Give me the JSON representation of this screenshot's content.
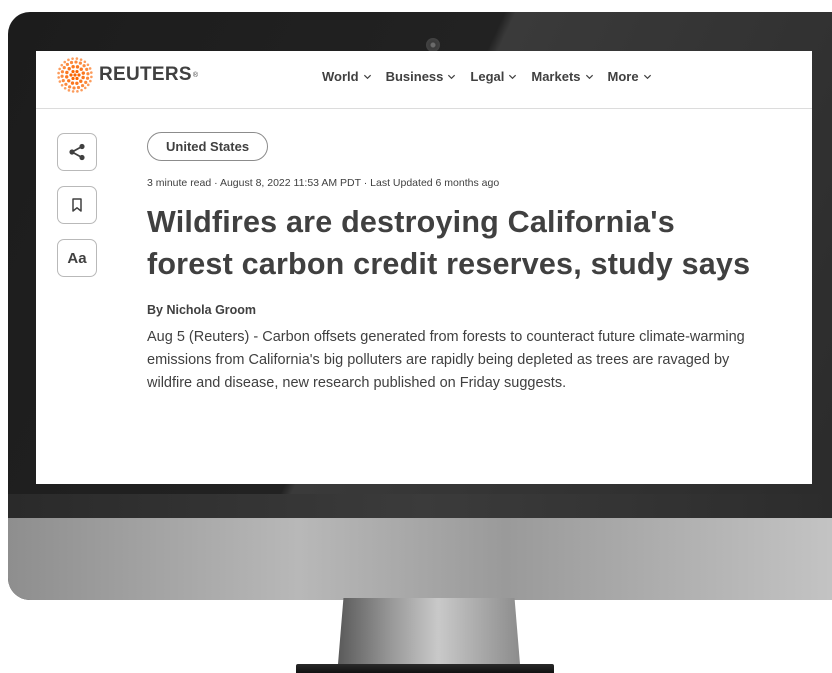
{
  "brand": {
    "name": "REUTERS",
    "registered": "®",
    "accent_color": "#FA6400"
  },
  "nav": {
    "items": [
      {
        "label": "World"
      },
      {
        "label": "Business"
      },
      {
        "label": "Legal"
      },
      {
        "label": "Markets"
      },
      {
        "label": "More"
      }
    ]
  },
  "tools": {
    "share_icon": "share-icon",
    "bookmark_icon": "bookmark-icon",
    "font_size_label": "Aa"
  },
  "article": {
    "tag": "United States",
    "meta": "3 minute read · August 8, 2022 11:53 AM PDT · Last Updated 6 months ago",
    "headline": "Wildfires are destroying California's forest carbon credit reserves, study says",
    "byline": "By Nichola Groom",
    "body": "Aug 5 (Reuters) - Carbon offsets generated from forests to counteract future climate-warming emissions from California's big polluters are rapidly being depleted as trees are ravaged by wildfire and disease, new research published on Friday suggests."
  }
}
